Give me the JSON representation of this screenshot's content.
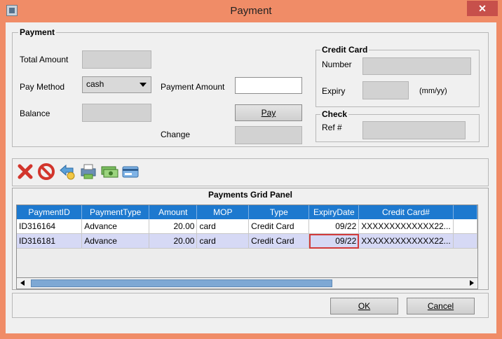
{
  "window": {
    "title": "Payment",
    "close_glyph": "✕"
  },
  "payment": {
    "legend": "Payment",
    "total_amount_label": "Total Amount",
    "pay_method_label": "Pay Method",
    "pay_method_value": "cash",
    "payment_amount_label": "Payment Amount",
    "payment_amount_value": "",
    "balance_label": "Balance",
    "pay_button": "Pay",
    "change_label": "Change"
  },
  "credit_card": {
    "legend": "Credit Card",
    "number_label": "Number",
    "expiry_label": "Expiry",
    "expiry_hint": "(mm/yy)"
  },
  "check": {
    "legend": "Check",
    "ref_label": "Ref #"
  },
  "toolbar": {
    "icons": [
      "delete-icon",
      "cancel-icon",
      "back-icon",
      "print-icon",
      "cash-icon",
      "card-icon"
    ]
  },
  "grid": {
    "title": "Payments Grid Panel",
    "columns": [
      "PaymentID",
      "PaymentType",
      "Amount",
      "MOP",
      "Type",
      "ExpiryDate",
      "Credit Card#"
    ],
    "rows": [
      [
        "ID316164",
        "Advance",
        "20.00",
        "card",
        "Credit Card",
        "09/22",
        "XXXXXXXXXXXXX22..."
      ],
      [
        "ID316181",
        "Advance",
        "20.00",
        "card",
        "Credit Card",
        "09/22",
        "XXXXXXXXXXXXX22..."
      ]
    ]
  },
  "footer": {
    "ok_button": "OK",
    "cancel_button": "Cancel"
  },
  "colors": {
    "titlebar": "#f08c67",
    "grid_header": "#1d79cf",
    "selected_row": "#d6d9f5"
  }
}
